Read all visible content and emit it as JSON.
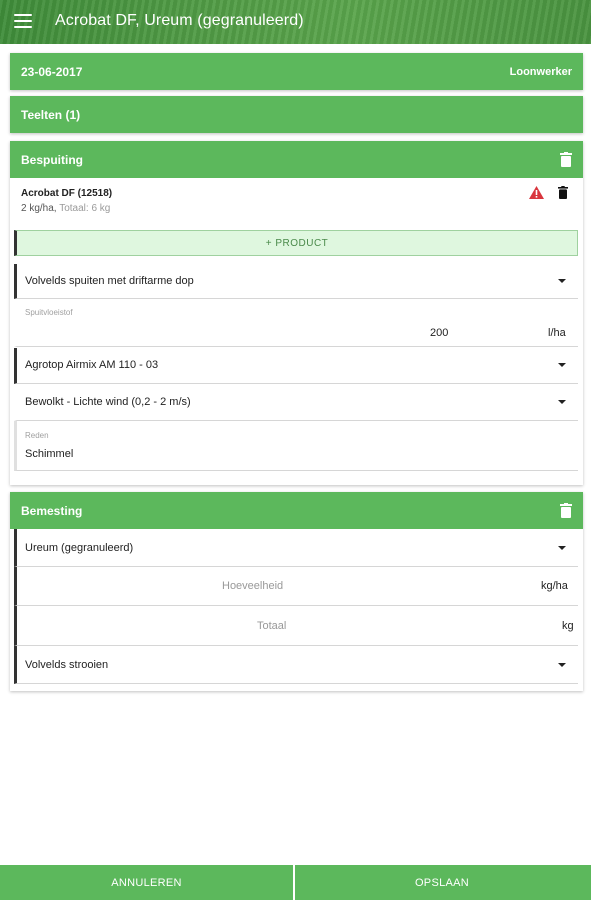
{
  "appbar": {
    "title": "Acrobat DF, Ureum (gegranuleerd)"
  },
  "date_card": {
    "date": "23-06-2017",
    "role": "Loonwerker"
  },
  "teelten_card": {
    "title": "Teelten (1)"
  },
  "bespuiting": {
    "title": "Bespuiting",
    "product": {
      "name": "Acrobat DF (12518)",
      "dose": "2 kg/ha,",
      "total": "Totaal: 6 kg"
    },
    "add_product_label": "+ PRODUCT",
    "method": "Volvelds spuiten met driftarme dop",
    "carrier": {
      "label": "Spuitvloeistof",
      "value": "200",
      "unit": "l/ha"
    },
    "nozzle": "Agrotop Airmix AM 110 - 03",
    "weather": "Bewolkt - Lichte wind (0,2 - 2 m/s)",
    "reason": {
      "label": "Reden",
      "value": "Schimmel"
    }
  },
  "bemesting": {
    "title": "Bemesting",
    "fertilizer": "Ureum (gegranuleerd)",
    "quantity": {
      "placeholder": "Hoeveelheid",
      "unit": "kg/ha"
    },
    "total": {
      "placeholder": "Totaal",
      "unit": "kg"
    },
    "method": "Volvelds strooien"
  },
  "footer": {
    "cancel_label": "ANNULEREN",
    "save_label": "OPSLAAN"
  },
  "colors": {
    "primary": "#5cb85c",
    "warning": "#d9363e",
    "add_bg": "#dff7df"
  },
  "icons": {
    "menu": "menu-icon",
    "delete": "trash-icon",
    "warning": "warning-icon",
    "dropdown": "caret-down-icon"
  }
}
